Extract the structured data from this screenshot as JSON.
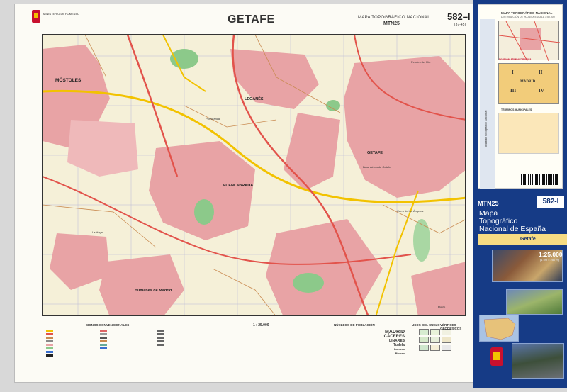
{
  "header": {
    "ministry": "MINISTERIO DE FOMENTO",
    "title": "GETAFE",
    "series": "MAPA TOPOGRÁFICO NACIONAL",
    "series_code": "MTN25",
    "sheet": "582–I",
    "sheet_sub": "(37-45)"
  },
  "map": {
    "places": {
      "mostoles": "MÓSTOLES",
      "leganes": "LEGANÉS",
      "getafe": "GETAFE",
      "fuenlabrada": "FUENLABRADA",
      "humanes": "Humanes de Madrid",
      "base": "Base Aérea de Getafe",
      "pinto": "Pinto",
      "perales": "Perales del Río",
      "lahoya": "La Hoya",
      "polvoranca": "Polvoranca",
      "cerrocruces": "Cerro de los Ángeles"
    },
    "colors": {
      "urban": "#e8a3a5",
      "green": "#8cc98a",
      "terrain": "#f5f0d8",
      "road": "#e2534b",
      "highway": "#f2c200"
    }
  },
  "legend": {
    "signos": "SIGNOS CONVENCIONALES",
    "scale": "1 : 25.000",
    "nucleos": "NÚCLEOS DE POBLACIÓN",
    "usos": "USOS DEL SUELO",
    "vertices": "VÉRTICES GEODÉSICOS",
    "towns": [
      "MADRID",
      "CÁCERES",
      "LINARES",
      "Tudela",
      "Lardero",
      "Pinoso"
    ]
  },
  "side": {
    "panel_title": "MAPA TOPOGRÁFICO NACIONAL",
    "panel_sub": "DISTRIBUCIÓN DE HOJAS A ESCALA 1:50.000",
    "division": "DIVISIÓN ADMINISTRATIVA",
    "terminos": "TÉRMINOS MUNICIPALES",
    "grid_labels": [
      "I",
      "II",
      "III",
      "IV"
    ],
    "grid_region": "MADRID",
    "strip_text": "Instituto Geográfico Nacional",
    "mtn25": "MTN25",
    "sheet_no": "582-I",
    "brand_lines": [
      "Mapa",
      "Topográfico",
      "Nacional de España"
    ],
    "place": "Getafe",
    "scale": "1:25.000",
    "scale_note": "(1 cm = 250 m)"
  }
}
